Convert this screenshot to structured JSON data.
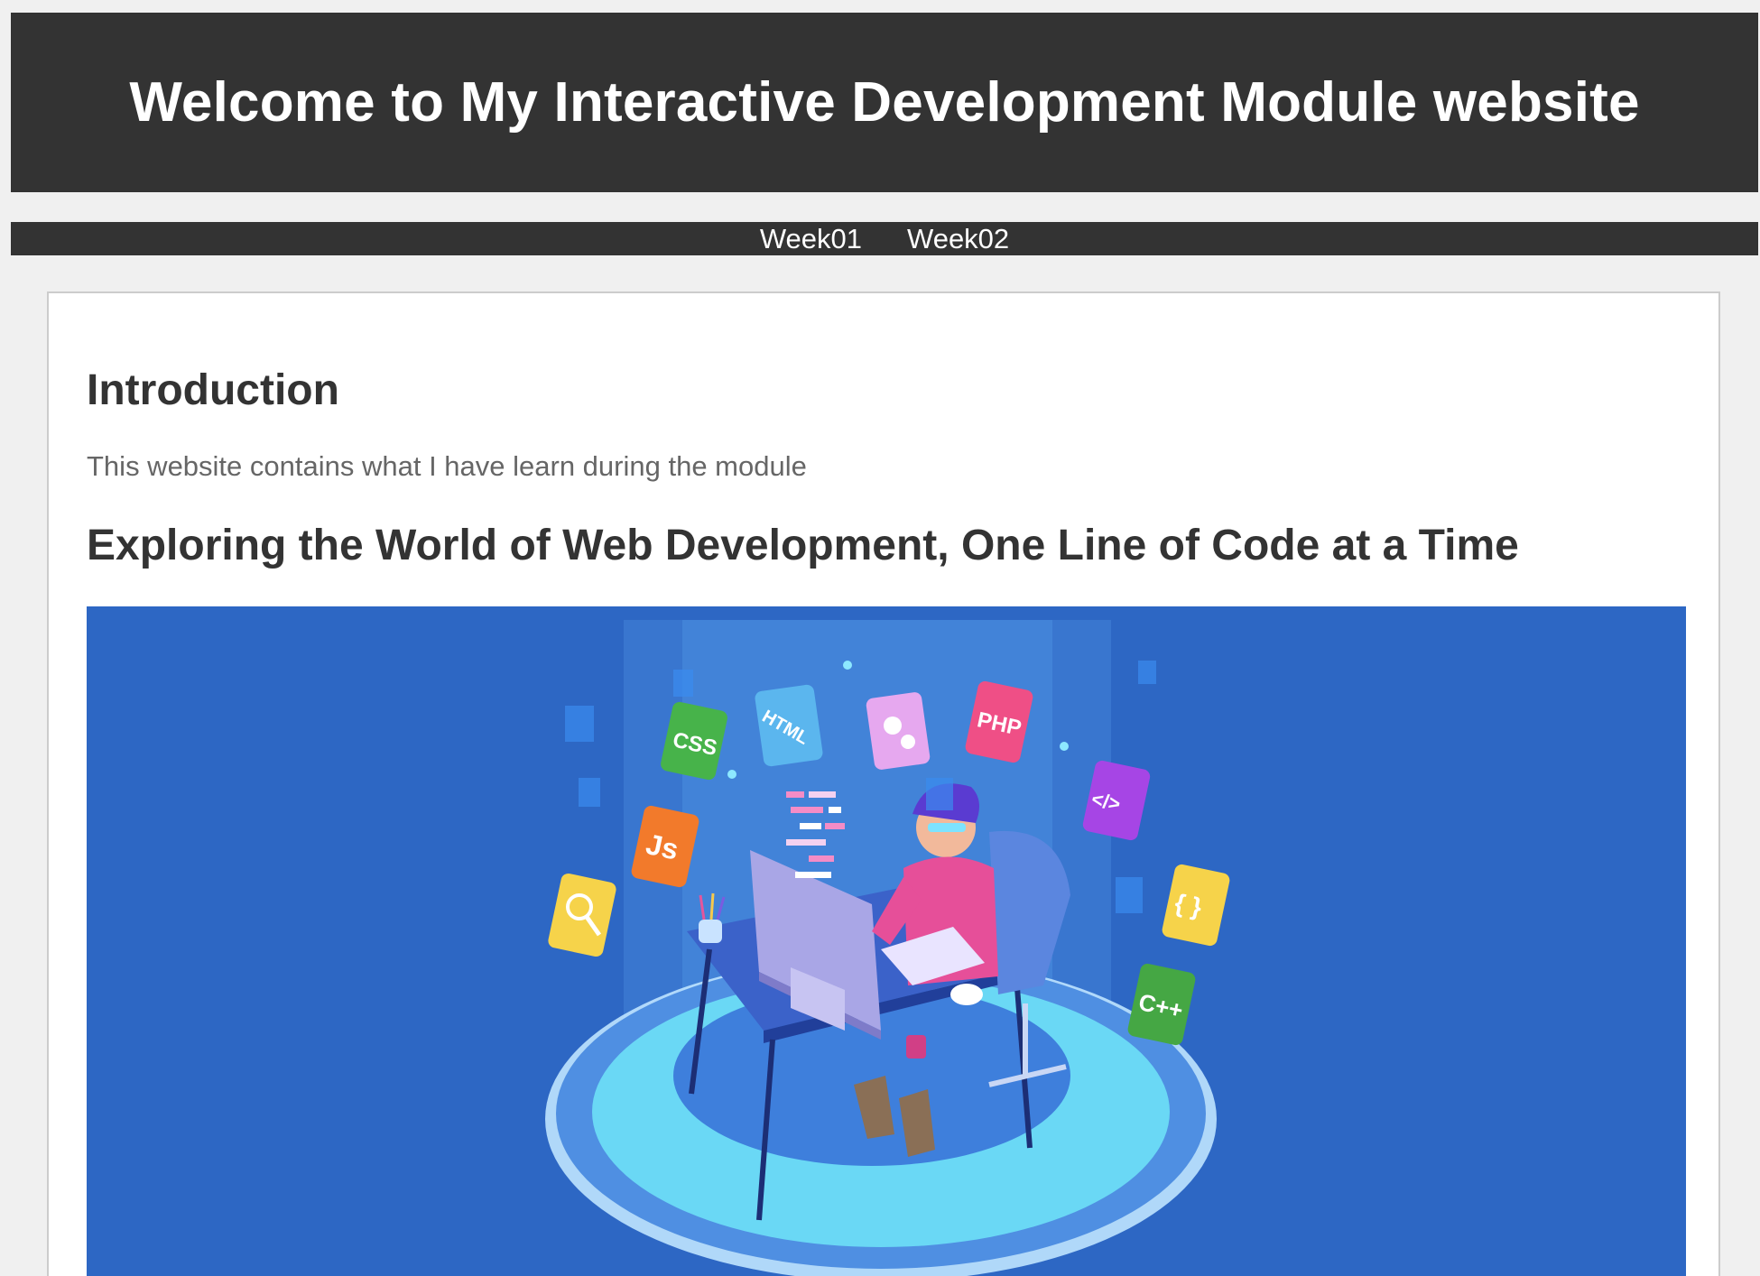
{
  "header": {
    "title": "Welcome to My Interactive Development Module website"
  },
  "nav": {
    "links": [
      {
        "label": "Week01"
      },
      {
        "label": "Week02"
      }
    ]
  },
  "main": {
    "intro_heading": "Introduction",
    "intro_text": "This website contains what I have learn during the module",
    "tagline_heading": "Exploring the World of Web Development, One Line of Code at a Time"
  },
  "hero": {
    "icons": {
      "css": "CSS",
      "html": "HTML",
      "php": "PHP",
      "js": "Js",
      "code": "</>",
      "braces": "{ }",
      "cpp": "C++"
    }
  },
  "colors": {
    "header_bg": "#333333",
    "page_bg": "#f0f0f0",
    "hero_bg": "#2d67c4"
  }
}
